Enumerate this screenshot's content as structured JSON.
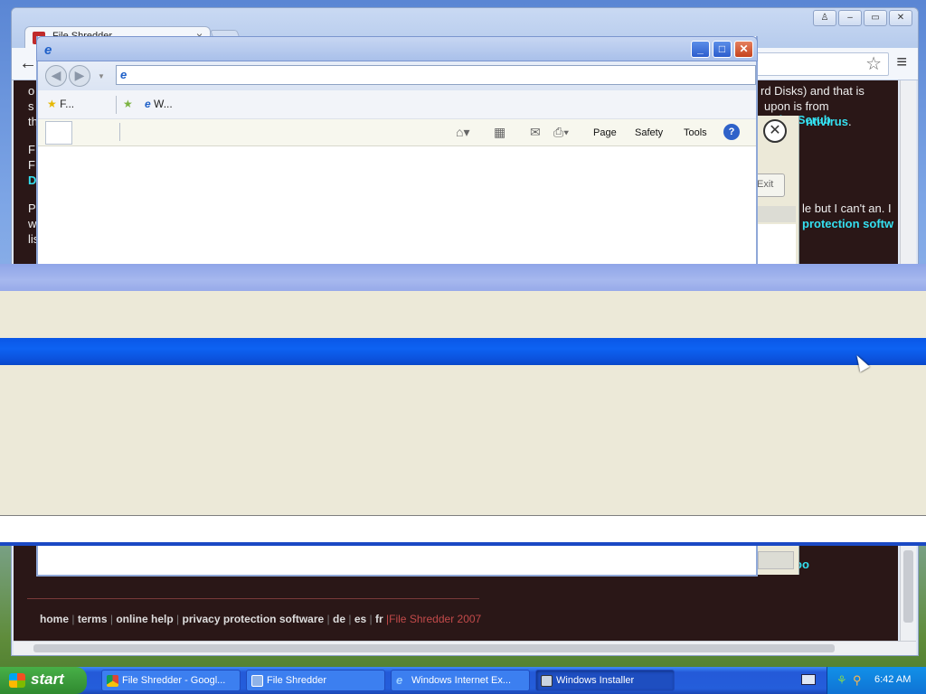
{
  "chrome": {
    "tab_title": "File Shredder",
    "tab_close": "×",
    "back": "←",
    "star": "☆",
    "menu": "≡",
    "window_buttons": [
      "♙",
      "–",
      "▭",
      "✕"
    ],
    "page": {
      "line1_left": "o",
      "line1_right": "rd Disks) and that is",
      "line2_left": "s",
      "line2_right_plain": "upon is from ",
      "line2_right_link": "CyberScrub",
      "line3_left": "th",
      "line3_right_link": "ntivirus",
      "line3_right_end": ".",
      "line4_left": "F",
      "line5_left": "F",
      "line6_left_link": "D",
      "line7_left": "P",
      "line7_right": "le but I can't an. I",
      "line8_left": "w",
      "line8_right_link": "protection softw",
      "line9_left": "lis",
      "lower_link": "oo"
    },
    "footer": {
      "links": [
        "home",
        "terms",
        "online help",
        "privacy protection software",
        "de",
        "es",
        "fr"
      ],
      "separator": "|",
      "copyright": "|File Shredder 2007"
    }
  },
  "fs_dialog": {
    "close": "✕",
    "exit_label": "Exit"
  },
  "ie": {
    "logo": "e",
    "buttons": {
      "minimize": "_",
      "maximize": "□",
      "close": "✕"
    },
    "address_value": "",
    "favorites": [
      {
        "icon": "favorites-star-icon",
        "label": "F..."
      },
      {
        "icon": "web-slice-icon",
        "label": "W..."
      }
    ],
    "commands": {
      "page": "Page",
      "safety": "Safety",
      "tools": "Tools",
      "help": "?"
    }
  },
  "taskbar": {
    "start_label": "start",
    "tasks": [
      {
        "label": "File Shredder - Googl...",
        "icon": "chrome-icon",
        "active": false
      },
      {
        "label": "File Shredder",
        "icon": "file-shredder-icon",
        "active": false
      },
      {
        "label": "Windows Internet Ex...",
        "icon": "ie-icon",
        "active": false
      },
      {
        "label": "Windows Installer",
        "icon": "installer-icon",
        "active": true
      }
    ],
    "clock": "6:42 AM"
  },
  "colors": {
    "installer_titlebar": "#0b55e8",
    "page_link": "#34e0f0",
    "page_background": "#2a1717"
  }
}
